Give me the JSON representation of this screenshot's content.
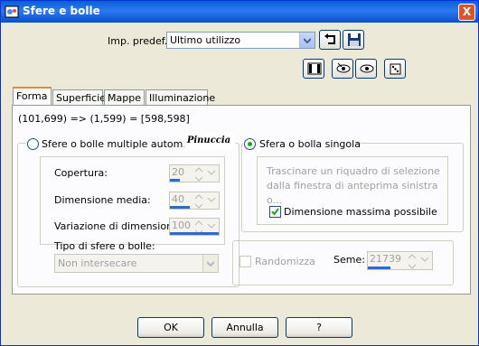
{
  "window": {
    "title": "Sfere e bolle",
    "close_glyph": "X"
  },
  "preset": {
    "label": "Imp. predef.:",
    "value": "Ultimo utilizzo"
  },
  "tabs": [
    {
      "label": "Forma",
      "active": true
    },
    {
      "label": "Superficie"
    },
    {
      "label": "Mappe"
    },
    {
      "label": "Illuminazione"
    }
  ],
  "coords_text": "(101,699) => (1,599) = [598,598]",
  "stamp_text": "Pinuccia",
  "left": {
    "radio_label": "Sfere o bolle multiple automatiche",
    "coverage": {
      "label": "Copertura:",
      "value": "20",
      "fill": 0.2
    },
    "avg_size": {
      "label": "Dimensione media:",
      "value": "40",
      "fill": 0.4
    },
    "size_var": {
      "label": "Variazione di dimensione:",
      "value": "100",
      "fill": 1.0
    },
    "type": {
      "label": "Tipo di sfere o bolle:",
      "value": "Non intersecare"
    }
  },
  "right": {
    "radio_label": "Sfera o bolla singola",
    "hint": "Trascinare un riquadro di selezione dalla finestra di anteprima sinistra o...",
    "max_size_label": "Dimensione massima possibile"
  },
  "random": {
    "label": "Randomizza",
    "seed_label": "Seme:",
    "seed_value": "21739",
    "fill": 0.35
  },
  "buttons": {
    "ok": "OK",
    "cancel": "Annulla",
    "help": "?"
  },
  "colors": {
    "accent": "#0a5fd7",
    "tab_highlight": "#e68b2c",
    "radio_dot": "#21a121"
  }
}
